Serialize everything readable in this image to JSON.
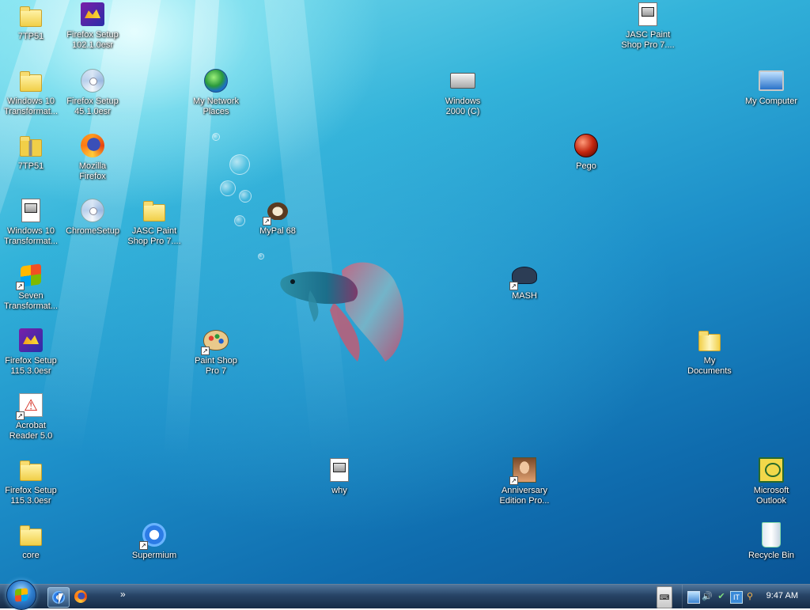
{
  "desktop": {
    "icons": [
      {
        "id": "7tp51-folder-a",
        "label": "7TP51",
        "icon": "folder-icon"
      },
      {
        "id": "firefox-setup-102",
        "label": "Firefox Setup\n102.1.0esr",
        "icon": "installer-box-icon"
      },
      {
        "id": "jasc-paint-shop-doc",
        "label": "JASC Paint\nShop Pro 7....",
        "icon": "document-icon"
      },
      {
        "id": "win10-transform-folder",
        "label": "Windows 10\nTransformat...",
        "icon": "folder-icon"
      },
      {
        "id": "firefox-setup-45",
        "label": "Firefox Setup\n45.1.0esr",
        "icon": "cd-installer-icon"
      },
      {
        "id": "my-network-places",
        "label": "My Network\nPlaces",
        "icon": "network-globe-icon"
      },
      {
        "id": "windows-2000-c",
        "label": "Windows\n2000 (C)",
        "icon": "hard-drive-icon"
      },
      {
        "id": "my-computer",
        "label": "My Computer",
        "icon": "computer-icon"
      },
      {
        "id": "7tp51-zip",
        "label": "7TP51",
        "icon": "zip-folder-icon"
      },
      {
        "id": "mozilla-firefox",
        "label": "Mozilla\nFirefox",
        "icon": "firefox-icon"
      },
      {
        "id": "pego",
        "label": "Pego",
        "icon": "red-ball-icon"
      },
      {
        "id": "win10-transform-doc",
        "label": "Windows 10\nTransformat...",
        "icon": "document-icon"
      },
      {
        "id": "chromesetup",
        "label": "ChromeSetup",
        "icon": "cd-installer-icon"
      },
      {
        "id": "jasc-paint-shop-folder",
        "label": "JASC Paint\nShop Pro 7....",
        "icon": "folder-icon"
      },
      {
        "id": "mypal-68",
        "label": "MyPal 68",
        "icon": "mypal-icon"
      },
      {
        "id": "seven-transform",
        "label": "Seven\nTransformat...",
        "icon": "windows-logo-icon"
      },
      {
        "id": "mash",
        "label": "MASH",
        "icon": "spy-hat-icon"
      },
      {
        "id": "firefox-setup-115-box",
        "label": "Firefox Setup\n115.3.0esr",
        "icon": "installer-box-icon"
      },
      {
        "id": "paint-shop-pro-7",
        "label": "Paint Shop\nPro 7",
        "icon": "palette-icon"
      },
      {
        "id": "my-documents",
        "label": "My\nDocuments",
        "icon": "documents-folder-icon"
      },
      {
        "id": "acrobat-reader-5",
        "label": "Acrobat\nReader 5.0",
        "icon": "acrobat-icon"
      },
      {
        "id": "firefox-setup-115-folder",
        "label": "Firefox Setup\n115.3.0esr",
        "icon": "folder-icon"
      },
      {
        "id": "why",
        "label": "why",
        "icon": "notepad-doc-icon"
      },
      {
        "id": "anniversary-edition",
        "label": "Anniversary\nEdition Pro...",
        "icon": "portrait-icon"
      },
      {
        "id": "microsoft-outlook",
        "label": "Microsoft\nOutlook",
        "icon": "outlook-icon"
      },
      {
        "id": "core",
        "label": "core",
        "icon": "folder-icon"
      },
      {
        "id": "supermium",
        "label": "Supermium",
        "icon": "supermium-icon"
      },
      {
        "id": "recycle-bin",
        "label": "Recycle Bin",
        "icon": "recycle-bin-icon"
      }
    ]
  },
  "taskbar": {
    "start_button": "start-orb-icon",
    "quick_launch": [
      "chrome-icon",
      "firefox-icon"
    ],
    "chevron": "»",
    "language": "⌨",
    "tray_icons": [
      "network-icon",
      "volume-icon",
      "shield-icon",
      "ime-icon",
      "search-icon"
    ],
    "clock": "9:47 AM"
  }
}
